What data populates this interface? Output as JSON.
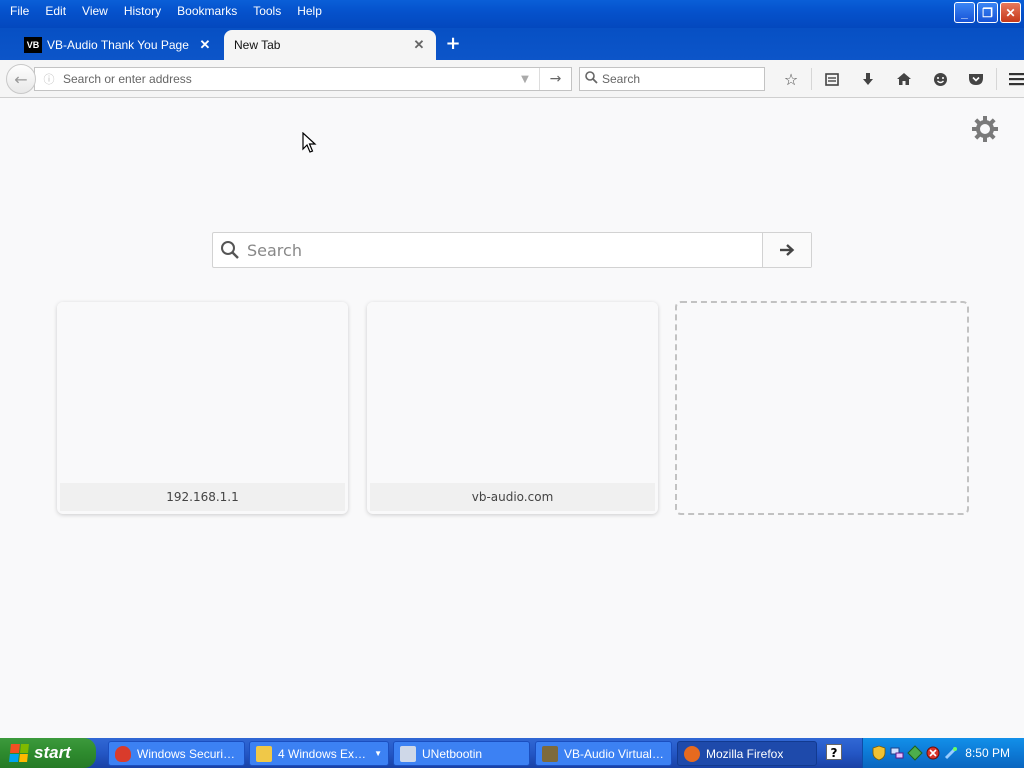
{
  "menubar": {
    "items": [
      "File",
      "Edit",
      "View",
      "History",
      "Bookmarks",
      "Tools",
      "Help"
    ]
  },
  "window_controls": {
    "minimize": "_",
    "restore": "❐",
    "close": "✕"
  },
  "tabs": [
    {
      "label": "VB-Audio Thank You Page",
      "favicon_text": "VB",
      "active": false
    },
    {
      "label": "New Tab",
      "active": true
    }
  ],
  "newtab_button": "+",
  "navbar": {
    "url_placeholder": "Search or enter address",
    "search_placeholder": "Search"
  },
  "newtab_page": {
    "search_placeholder": "Search",
    "tiles": [
      {
        "title": "192.168.1.1"
      },
      {
        "title": "vb-audio.com"
      },
      {
        "title": ""
      }
    ]
  },
  "taskbar": {
    "start_label": "start",
    "tasks": [
      {
        "label": "Windows Security...",
        "icon": "shield-icon",
        "color": "#d93b2b"
      },
      {
        "label": "4 Windows Expl...",
        "icon": "folder-icon",
        "color": "#f0c848",
        "has_group_arrow": true
      },
      {
        "label": "UNetbootin",
        "icon": "unetbootin-icon",
        "color": "#cfd8e8"
      },
      {
        "label": "VB-Audio Virtual A...",
        "icon": "speaker-icon",
        "color": "#7d6a3c"
      },
      {
        "label": "Mozilla Firefox",
        "icon": "firefox-icon",
        "color": "#e66a1f",
        "active": true
      }
    ],
    "clock": "8:50 PM"
  },
  "colors": {
    "xp_blue": "#0552cc",
    "tray_blue": "#0d7ad6",
    "start_green": "#2e8b2e",
    "content_bg": "#f9f9fa"
  }
}
